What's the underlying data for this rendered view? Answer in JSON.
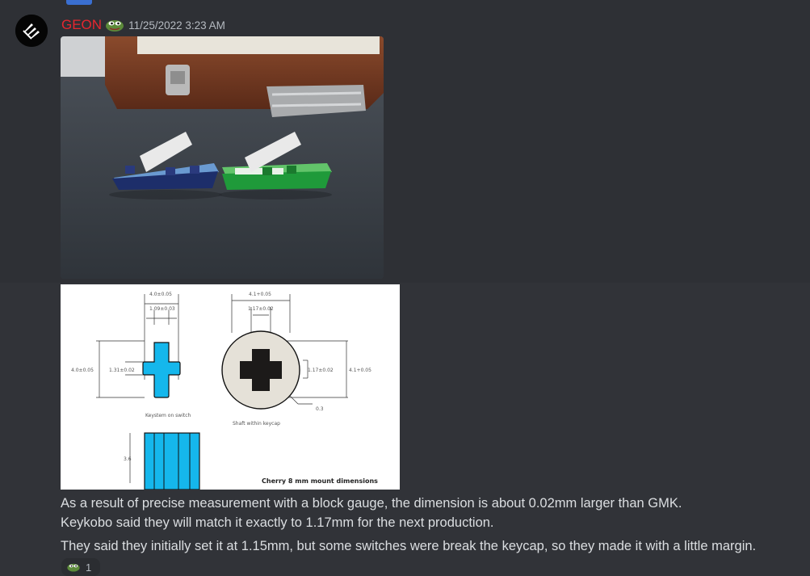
{
  "message": {
    "username": "GEON",
    "timestamp": "11/25/2022 3:23 AM",
    "badge_icon": "pepe-emoji-icon",
    "lines": [
      "As a result of precise measurement with a block gauge, the dimension is about 0.02mm larger than GMK.",
      "Keykobo said they will match it exactly to 1.17mm for the next production.",
      "They said they initially set it at 1.15mm, but some switches were break the keycap, so they made it with a little margin."
    ],
    "reaction": {
      "emoji": "pepe-emoji-icon",
      "count": "1"
    }
  },
  "diagram": {
    "stem_width": "4.0±0.05",
    "stem_arm": "1.09±0.03",
    "stem_height": "4.0±0.05",
    "stem_arm_v": "1.31±0.02",
    "stem_caption": "Keystem on switch",
    "shaft_width": "4.1+0.05",
    "shaft_arm": "1.17±0.02",
    "shaft_arm_v": "1.17±0.02",
    "shaft_height": "4.1+0.05",
    "shaft_radius": "0.3",
    "shaft_caption": "Shaft within keycap",
    "side_height": "3.6",
    "title": "Cherry 8 mm mount dimensions"
  }
}
